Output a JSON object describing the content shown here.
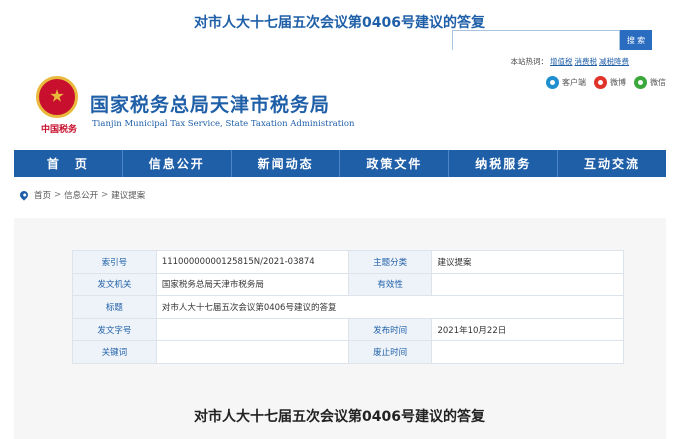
{
  "article_title": "对市人大十七届五次会议第0406号建议的答复",
  "header": {
    "emblem_caption": "中国税务",
    "site_name": "国家税务总局天津市税务局",
    "site_name_en": "Tianjin Municipal Tax Service, State Taxation Administration",
    "social": [
      {
        "icon": "client-icon",
        "label": "客户端"
      },
      {
        "icon": "weibo-icon",
        "label": "微博"
      },
      {
        "icon": "weixin-icon",
        "label": "微信"
      }
    ],
    "search_placeholder": "",
    "search_button": "搜 索",
    "hot_search_label": "本站热词：",
    "hot_terms": [
      "增值税",
      "消费税",
      "减税降费"
    ]
  },
  "nav": {
    "items": [
      "首　页",
      "信息公开",
      "新闻动态",
      "政策文件",
      "纳税服务",
      "互动交流"
    ]
  },
  "breadcrumb": [
    "首页",
    "信息公开",
    "建议提案"
  ],
  "breadcrumb_sep": ">",
  "meta": {
    "rows": [
      {
        "l1": "索引号",
        "v1": "11100000000125815N/2021-03874",
        "l2": "主题分类",
        "v2": "建议提案"
      },
      {
        "l1": "发文机关",
        "v1": "国家税务总局天津市税务局",
        "l2": "有效性",
        "v2": ""
      },
      {
        "l1": "标题",
        "v1": "对市人大十七届五次会议第0406号建议的答复"
      },
      {
        "l1": "发文字号",
        "v1": "",
        "l2": "发布时间",
        "v2": "2021年10月22日"
      },
      {
        "l1": "关键词",
        "v1": "",
        "l2": "废止时间",
        "v2": ""
      }
    ]
  },
  "content_title": "对市人大十七届五次会议第0406号建议的答复",
  "colors": {
    "brand_blue": "#1f5fa8",
    "emblem_red": "#c8102e",
    "emblem_gold": "#e8b93a"
  }
}
